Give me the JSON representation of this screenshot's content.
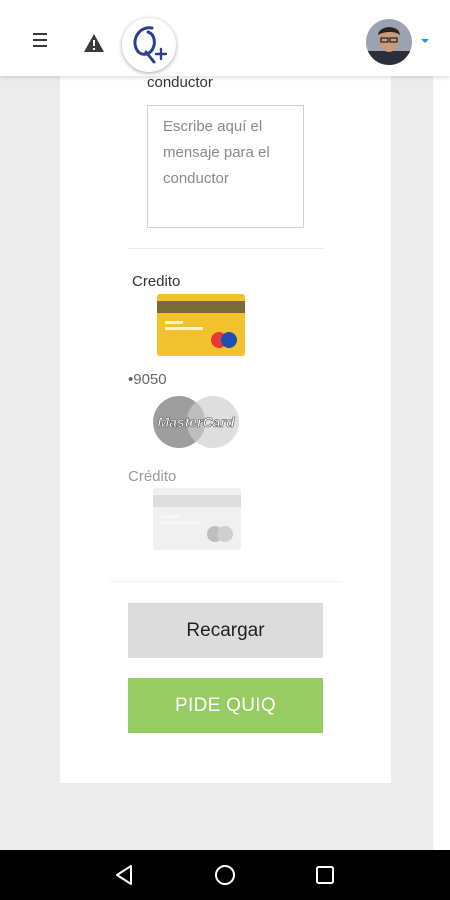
{
  "header": {
    "menu_icon": "hamburger-menu-icon",
    "warning_icon": "warning-icon",
    "logo_icon": "app-logo",
    "avatar_icon": "user-avatar",
    "dropdown_icon": "caret-down-icon",
    "accent_color": "#2196f3"
  },
  "message": {
    "label": "conductor",
    "placeholder": "Escribe aquí el mensaje para el conductor"
  },
  "payment_methods": [
    {
      "label": "Credito",
      "icon": "yellow-credit-card-icon"
    },
    {
      "label": "•9050",
      "icon": "mastercard-icon"
    },
    {
      "label": "Crédito",
      "icon": "gray-credit-card-icon"
    }
  ],
  "buttons": {
    "recargar": "Recargar",
    "pide": "PIDE QUIQ",
    "pide_color": "#96cc62"
  },
  "navbar": {
    "back_icon": "back-triangle-icon",
    "home_icon": "home-circle-icon",
    "recents_icon": "recents-square-icon"
  }
}
